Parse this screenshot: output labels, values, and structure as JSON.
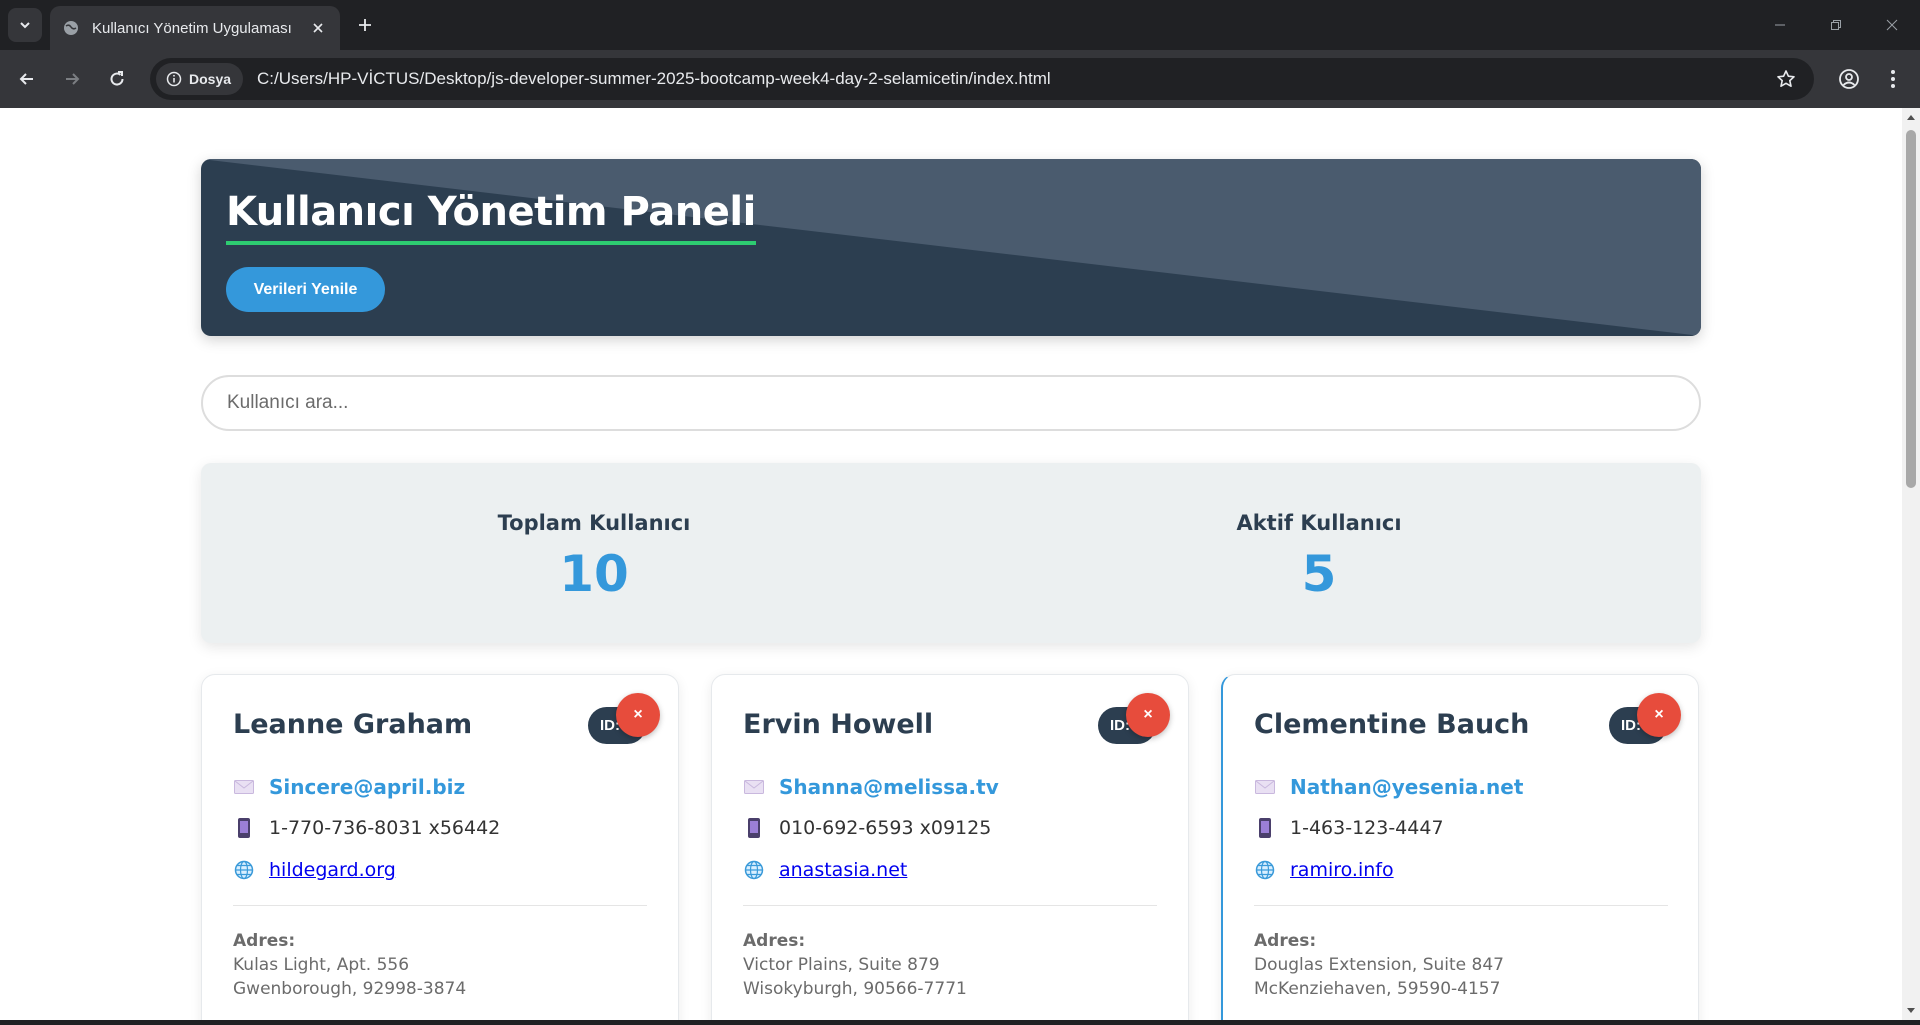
{
  "browser": {
    "tab_title": "Kullanıcı Yönetim Uygulaması",
    "site_chip": "Dosya",
    "url": "C:/Users/HP-VİCTUS/Desktop/js-developer-summer-2025-bootcamp-week4-day-2-selamicetin/index.html"
  },
  "colors": {
    "header_bg": "#2c3e50",
    "accent_blue": "#3498db",
    "accent_green": "#2ecc71",
    "delete_red": "#e74c3c",
    "stats_bg": "#ecf0f1"
  },
  "header": {
    "title": "Kullanıcı Yönetim Paneli",
    "refresh_label": "Verileri Yenile"
  },
  "search": {
    "placeholder": "Kullanıcı ara...",
    "value": ""
  },
  "stats": {
    "total_label": "Toplam Kullanıcı",
    "total_value": "10",
    "active_label": "Aktif Kullanıcı",
    "active_value": "5"
  },
  "users": [
    {
      "name": "Leanne Graham",
      "id_badge": "ID: 1",
      "delete_label": "×",
      "email": "Sincere@april.biz",
      "phone": "1-770-736-8031 x56442",
      "website": "hildegard.org",
      "address_label": "Adres:",
      "address_line1": "Kulas Light, Apt. 556",
      "address_line2": "Gwenborough, 92998-3874"
    },
    {
      "name": "Ervin Howell",
      "id_badge": "ID: 2",
      "delete_label": "×",
      "email": "Shanna@melissa.tv",
      "phone": "010-692-6593 x09125",
      "website": "anastasia.net",
      "address_label": "Adres:",
      "address_line1": "Victor Plains, Suite 879",
      "address_line2": "Wisokyburgh, 90566-7771"
    },
    {
      "name": "Clementine Bauch",
      "id_badge": "ID: 3",
      "delete_label": "×",
      "email": "Nathan@yesenia.net",
      "phone": "1-463-123-4447",
      "website": "ramiro.info",
      "address_label": "Adres:",
      "address_line1": "Douglas Extension, Suite 847",
      "address_line2": "McKenziehaven, 59590-4157"
    }
  ]
}
